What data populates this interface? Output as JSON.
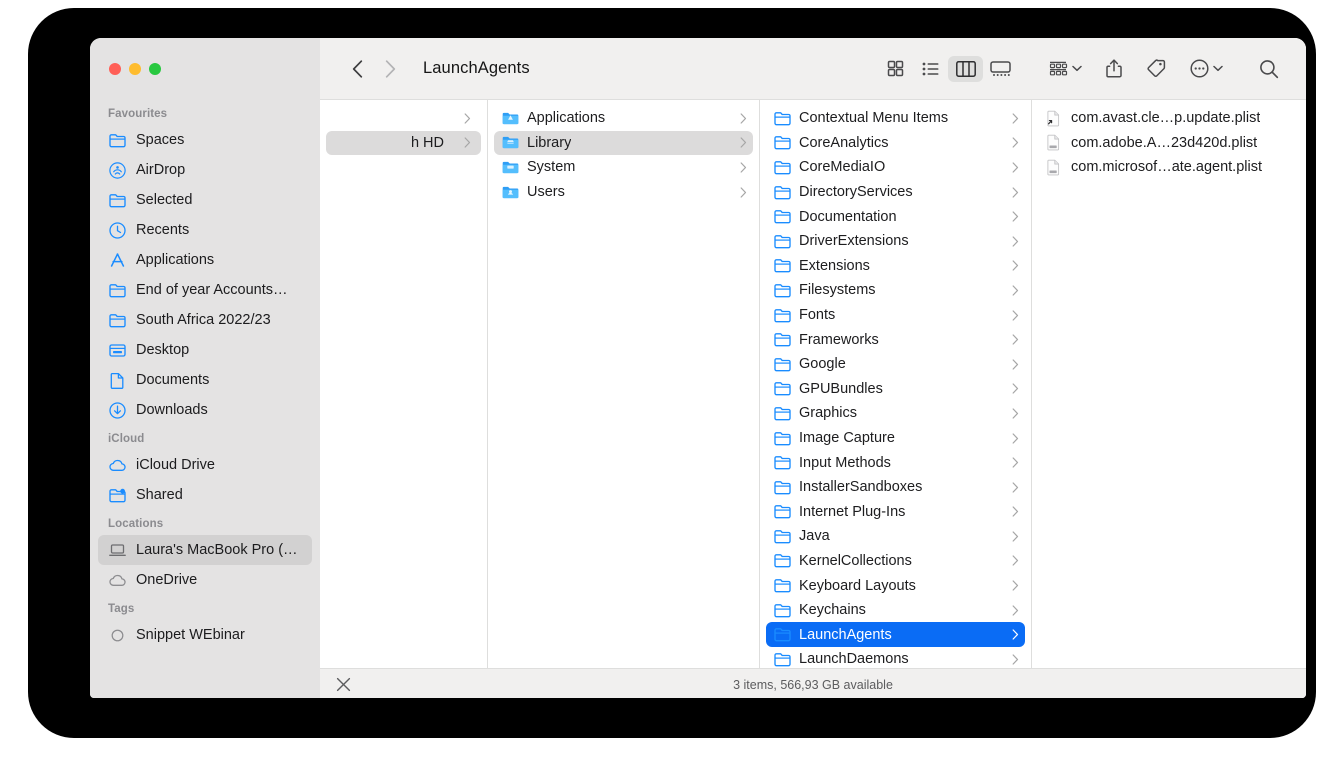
{
  "window": {
    "title": "LaunchAgents",
    "traffic_lights": [
      {
        "name": "close",
        "color": "#ff5f57"
      },
      {
        "name": "minimize",
        "color": "#febc2e"
      },
      {
        "name": "maximize",
        "color": "#28c840"
      }
    ]
  },
  "toolbar": {
    "back_icon": "chevron-left-icon",
    "forward_icon": "chevron-right-icon",
    "view_modes": [
      {
        "name": "icon-view",
        "icon": "grid-icon",
        "active": false
      },
      {
        "name": "list-view",
        "icon": "list-icon",
        "active": false
      },
      {
        "name": "column-view",
        "icon": "columns-icon",
        "active": true
      },
      {
        "name": "gallery-view",
        "icon": "gallery-icon",
        "active": false
      }
    ],
    "group_by_icon": "group-by-icon",
    "share_icon": "share-icon",
    "tag_icon": "tag-icon",
    "more_icon": "more-circle-icon",
    "search_icon": "search-icon"
  },
  "sidebar": {
    "sections": [
      {
        "title": "Favourites",
        "items": [
          {
            "label": "Spaces",
            "icon": "folder-icon",
            "selected": false
          },
          {
            "label": "AirDrop",
            "icon": "airdrop-icon",
            "selected": false
          },
          {
            "label": "Selected",
            "icon": "folder-icon",
            "selected": false
          },
          {
            "label": "Recents",
            "icon": "clock-icon",
            "selected": false
          },
          {
            "label": "Applications",
            "icon": "applications-icon",
            "selected": false
          },
          {
            "label": "End of year Accounts…",
            "icon": "folder-icon",
            "selected": false
          },
          {
            "label": "South Africa 2022/23",
            "icon": "folder-icon",
            "selected": false
          },
          {
            "label": "Desktop",
            "icon": "desktop-icon",
            "selected": false
          },
          {
            "label": "Documents",
            "icon": "document-icon",
            "selected": false
          },
          {
            "label": "Downloads",
            "icon": "downloads-icon",
            "selected": false
          }
        ]
      },
      {
        "title": "iCloud",
        "items": [
          {
            "label": "iCloud Drive",
            "icon": "cloud-icon",
            "selected": false
          },
          {
            "label": "Shared",
            "icon": "shared-folder-icon",
            "selected": false
          }
        ]
      },
      {
        "title": "Locations",
        "items": [
          {
            "label": "Laura's MacBook Pro (…",
            "icon": "laptop-icon",
            "selected": true
          },
          {
            "label": "OneDrive",
            "icon": "cloud-gray-icon",
            "selected": false
          }
        ]
      },
      {
        "title": "Tags",
        "items": [
          {
            "label": "Snippet WEbinar",
            "icon": "tag-circle-icon",
            "selected": false
          }
        ]
      }
    ]
  },
  "columns": [
    {
      "name": "column-volumes",
      "clipped": true,
      "items": [
        {
          "label": "",
          "icon": "none",
          "chevron": true,
          "selected": false
        },
        {
          "label": "h HD",
          "icon": "none",
          "chevron": true,
          "selected": true
        }
      ]
    },
    {
      "name": "column-root",
      "items": [
        {
          "label": "Applications",
          "icon": "folder-app-icon",
          "chevron": true,
          "selected": false
        },
        {
          "label": "Library",
          "icon": "folder-library-icon",
          "chevron": true,
          "selected": true
        },
        {
          "label": "System",
          "icon": "folder-system-icon",
          "chevron": true,
          "selected": false
        },
        {
          "label": "Users",
          "icon": "folder-users-icon",
          "chevron": true,
          "selected": false
        }
      ]
    },
    {
      "name": "column-library",
      "items": [
        {
          "label": "Contextual Menu Items",
          "icon": "folder-icon",
          "chevron": true,
          "selected": false
        },
        {
          "label": "CoreAnalytics",
          "icon": "folder-icon",
          "chevron": true,
          "selected": false
        },
        {
          "label": "CoreMediaIO",
          "icon": "folder-icon",
          "chevron": true,
          "selected": false
        },
        {
          "label": "DirectoryServices",
          "icon": "folder-icon",
          "chevron": true,
          "selected": false
        },
        {
          "label": "Documentation",
          "icon": "folder-icon",
          "chevron": true,
          "selected": false
        },
        {
          "label": "DriverExtensions",
          "icon": "folder-icon",
          "chevron": true,
          "selected": false
        },
        {
          "label": "Extensions",
          "icon": "folder-icon",
          "chevron": true,
          "selected": false
        },
        {
          "label": "Filesystems",
          "icon": "folder-icon",
          "chevron": true,
          "selected": false
        },
        {
          "label": "Fonts",
          "icon": "folder-icon",
          "chevron": true,
          "selected": false
        },
        {
          "label": "Frameworks",
          "icon": "folder-icon",
          "chevron": true,
          "selected": false
        },
        {
          "label": "Google",
          "icon": "folder-icon",
          "chevron": true,
          "selected": false
        },
        {
          "label": "GPUBundles",
          "icon": "folder-icon",
          "chevron": true,
          "selected": false
        },
        {
          "label": "Graphics",
          "icon": "folder-icon",
          "chevron": true,
          "selected": false
        },
        {
          "label": "Image Capture",
          "icon": "folder-icon",
          "chevron": true,
          "selected": false
        },
        {
          "label": "Input Methods",
          "icon": "folder-icon",
          "chevron": true,
          "selected": false
        },
        {
          "label": "InstallerSandboxes",
          "icon": "folder-icon",
          "chevron": true,
          "selected": false
        },
        {
          "label": "Internet Plug-Ins",
          "icon": "folder-icon",
          "chevron": true,
          "selected": false
        },
        {
          "label": "Java",
          "icon": "folder-icon",
          "chevron": true,
          "selected": false
        },
        {
          "label": "KernelCollections",
          "icon": "folder-icon",
          "chevron": true,
          "selected": false
        },
        {
          "label": "Keyboard Layouts",
          "icon": "folder-icon",
          "chevron": true,
          "selected": false
        },
        {
          "label": "Keychains",
          "icon": "folder-icon",
          "chevron": true,
          "selected": false
        },
        {
          "label": "LaunchAgents",
          "icon": "folder-icon",
          "chevron": true,
          "selected": true
        },
        {
          "label": "LaunchDaemons",
          "icon": "folder-icon",
          "chevron": true,
          "selected": false
        }
      ]
    },
    {
      "name": "column-launchagents",
      "items": [
        {
          "label": "com.avast.cle…p.update.plist",
          "icon": "plist-alias-icon",
          "chevron": false,
          "selected": false
        },
        {
          "label": "com.adobe.A…23d420d.plist",
          "icon": "plist-file-icon",
          "chevron": false,
          "selected": false
        },
        {
          "label": "com.microsof…ate.agent.plist",
          "icon": "plist-file-icon",
          "chevron": false,
          "selected": false
        }
      ]
    }
  ],
  "statusbar": {
    "close_icon": "close-x-icon",
    "text": "3 items, 566,93 GB available"
  },
  "colors": {
    "selection_blue": "#0a6cf5",
    "selection_gray": "#dcdbdb",
    "sidebar_bg": "#e4e3e3",
    "toolbar_bg": "#f1f0ef",
    "folder_blue": "#54befd"
  }
}
